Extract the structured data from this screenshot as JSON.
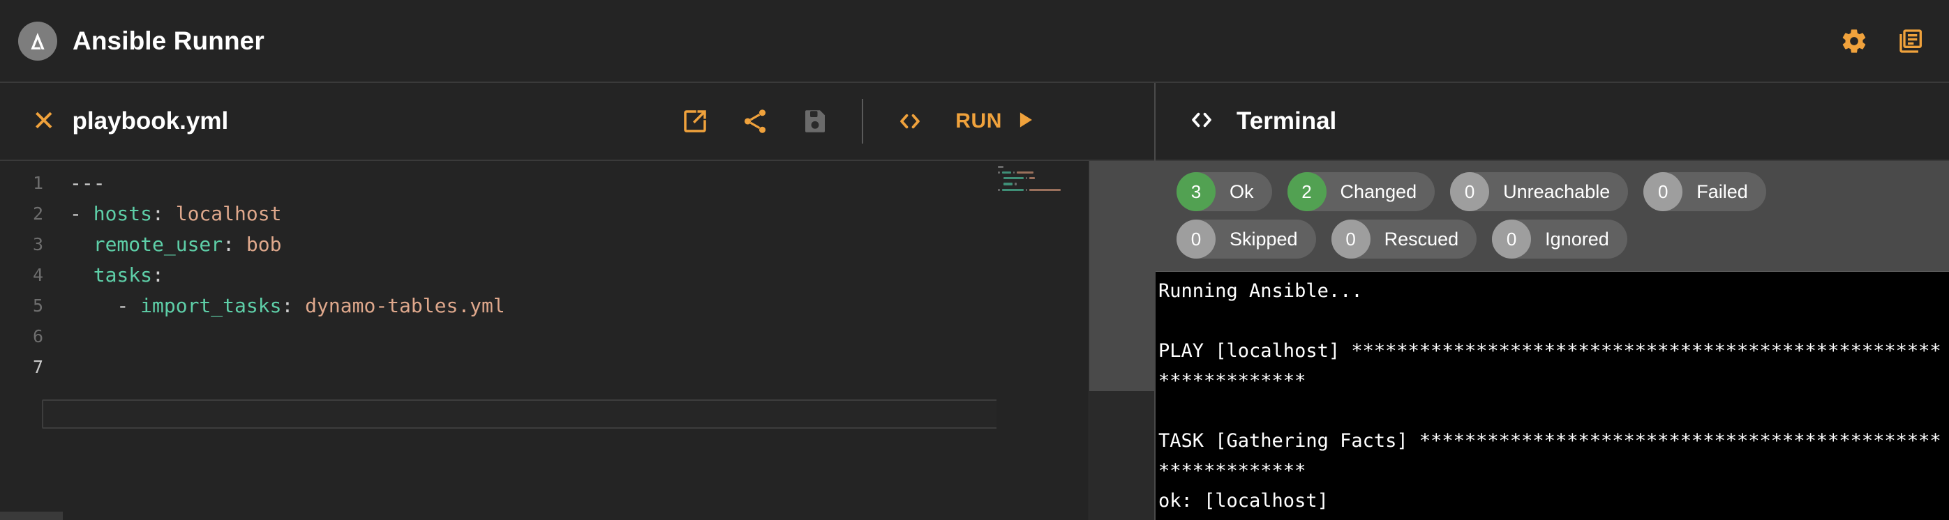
{
  "app": {
    "title": "Ansible Runner",
    "logo_icon": "ansible-logo-icon",
    "accent_color": "#f0a23c",
    "actions": [
      {
        "icon": "gear-icon",
        "name": "settings-button"
      },
      {
        "icon": "documents-icon",
        "name": "library-button"
      }
    ]
  },
  "editor": {
    "close_icon": "close-icon",
    "filename": "playbook.yml",
    "tools": [
      {
        "icon": "open-external-icon",
        "name": "open-external-button",
        "state": "enabled"
      },
      {
        "icon": "share-icon",
        "name": "share-button",
        "state": "enabled"
      },
      {
        "icon": "save-icon",
        "name": "save-button",
        "state": "disabled"
      }
    ],
    "code_toggle_icon": "code-brackets-icon",
    "run_label": "RUN",
    "run_icon": "play-icon",
    "active_line": 7,
    "line_numbers": [
      "1",
      "2",
      "3",
      "4",
      "5",
      "6",
      "7"
    ],
    "lines": [
      [
        {
          "t": "---",
          "c": "d"
        }
      ],
      [
        {
          "t": "- ",
          "c": "d"
        },
        {
          "t": "hosts",
          "c": "k"
        },
        {
          "t": ": ",
          "c": "p"
        },
        {
          "t": "localhost",
          "c": "v"
        }
      ],
      [
        {
          "t": "  ",
          "c": "d"
        },
        {
          "t": "remote_user",
          "c": "k"
        },
        {
          "t": ": ",
          "c": "p"
        },
        {
          "t": "bob",
          "c": "v"
        }
      ],
      [
        {
          "t": "  ",
          "c": "d"
        },
        {
          "t": "tasks",
          "c": "k"
        },
        {
          "t": ":",
          "c": "p"
        }
      ],
      [
        {
          "t": "    - ",
          "c": "d"
        },
        {
          "t": "import_tasks",
          "c": "k"
        },
        {
          "t": ": ",
          "c": "p"
        },
        {
          "t": "dynamo-tables.yml",
          "c": "v"
        }
      ],
      [],
      []
    ]
  },
  "terminal": {
    "icon": "code-brackets-icon",
    "title": "Terminal",
    "stats": [
      [
        {
          "count": "3",
          "label": "Ok",
          "color": "green"
        },
        {
          "count": "2",
          "label": "Changed",
          "color": "green"
        },
        {
          "count": "0",
          "label": "Unreachable",
          "color": "gray"
        },
        {
          "count": "0",
          "label": "Failed",
          "color": "gray"
        }
      ],
      [
        {
          "count": "0",
          "label": "Skipped",
          "color": "gray"
        },
        {
          "count": "0",
          "label": "Rescued",
          "color": "gray"
        },
        {
          "count": "0",
          "label": "Ignored",
          "color": "gray"
        }
      ]
    ],
    "output": "Running Ansible...\n\nPLAY [localhost] *****************************************************************\n\nTASK [Gathering Facts] ***********************************************************\nok: [localhost]"
  }
}
